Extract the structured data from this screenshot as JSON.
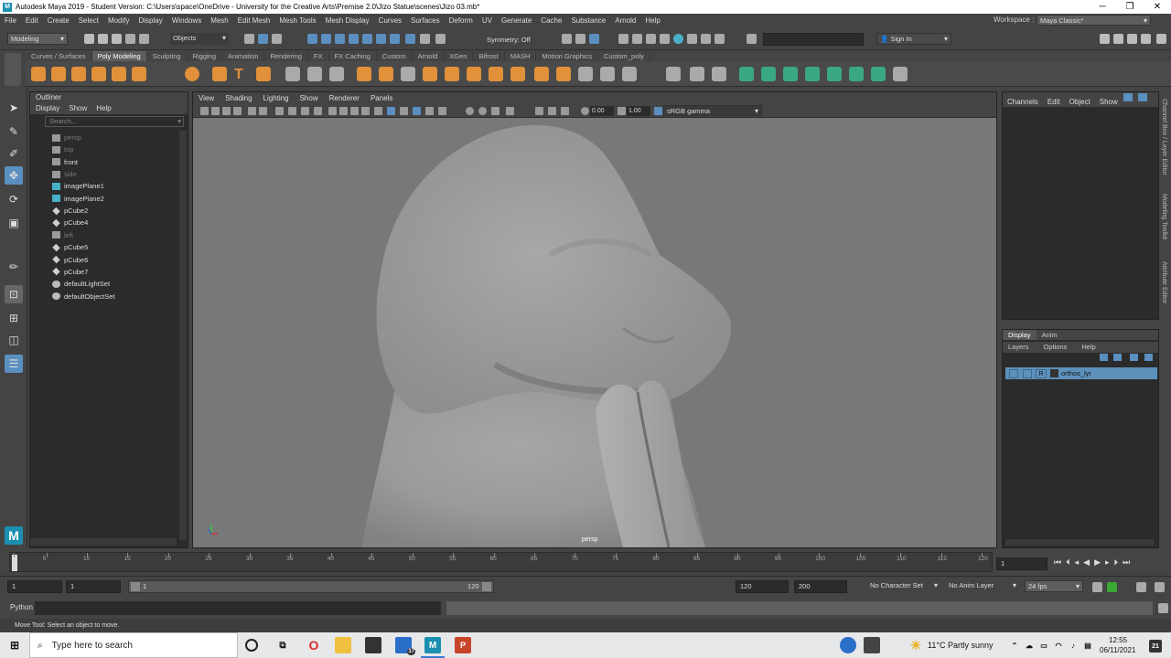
{
  "window": {
    "title": "Autodesk Maya 2019 - Student Version: C:\\Users\\space\\OneDrive - University for the Creative Arts\\Premise 2.0\\Jizo Statue\\scenes\\Jizo 03.mb*",
    "workspace_label": "Workspace :",
    "workspace_value": "Maya Classic*"
  },
  "menubar": [
    "File",
    "Edit",
    "Create",
    "Select",
    "Modify",
    "Display",
    "Windows",
    "Mesh",
    "Edit Mesh",
    "Mesh Tools",
    "Mesh Display",
    "Curves",
    "Surfaces",
    "Deform",
    "UV",
    "Generate",
    "Cache",
    "Substance",
    "Arnold",
    "Help"
  ],
  "statusline": {
    "menuset": "Modeling",
    "objects": "Objects",
    "symmetry": "Symmetry: Off",
    "sign_in": "Sign In"
  },
  "shelf_tabs": [
    "Curves / Surfaces",
    "Poly Modeling",
    "Sculpting",
    "Rigging",
    "Animation",
    "Rendering",
    "FX",
    "FX Caching",
    "Custom",
    "Arnold",
    "XGen",
    "Bifrost",
    "MASH",
    "Motion Graphics",
    "Custom_poly"
  ],
  "shelf_active": "Poly Modeling",
  "outliner": {
    "title": "Outliner",
    "menu": [
      "Display",
      "Show",
      "Help"
    ],
    "search_placeholder": "Search...",
    "items": [
      {
        "label": "persp",
        "dim": true,
        "icon": "camera-icon"
      },
      {
        "label": "top",
        "dim": true,
        "icon": "camera-icon"
      },
      {
        "label": "front",
        "dim": false,
        "icon": "camera-icon"
      },
      {
        "label": "side",
        "dim": true,
        "icon": "camera-icon"
      },
      {
        "label": "imagePlane1",
        "dim": false,
        "icon": "image-plane-icon"
      },
      {
        "label": "imagePlane2",
        "dim": false,
        "icon": "image-plane-icon"
      },
      {
        "label": "pCube2",
        "dim": false,
        "icon": "mesh-icon"
      },
      {
        "label": "pCube4",
        "dim": false,
        "icon": "mesh-icon"
      },
      {
        "label": "left",
        "dim": true,
        "icon": "camera-icon"
      },
      {
        "label": "pCube5",
        "dim": false,
        "icon": "mesh-icon"
      },
      {
        "label": "pCube6",
        "dim": false,
        "icon": "mesh-icon"
      },
      {
        "label": "pCube7",
        "dim": false,
        "icon": "mesh-icon"
      },
      {
        "label": "defaultLightSet",
        "dim": false,
        "icon": "set-icon"
      },
      {
        "label": "defaultObjectSet",
        "dim": false,
        "icon": "set-icon"
      }
    ]
  },
  "viewport": {
    "menu": [
      "View",
      "Shading",
      "Lighting",
      "Show",
      "Renderer",
      "Panels"
    ],
    "value1": "0.00",
    "value2": "1.00",
    "colorspace": "sRGB gamma",
    "camera_label": "persp"
  },
  "channelbox": {
    "menu": [
      "Channels",
      "Edit",
      "Object",
      "Show"
    ]
  },
  "layers": {
    "tabs": [
      "Display",
      "Anim"
    ],
    "menu": [
      "Layers",
      "Options",
      "Help"
    ],
    "layer_name": "orthos_lyr",
    "r_label": "R"
  },
  "side_tabs": [
    "Channel Box / Layer Editor",
    "Modeling Toolkit",
    "Attribute Editor"
  ],
  "timeline": {
    "ticks": [
      1,
      5,
      10,
      15,
      20,
      25,
      30,
      35,
      40,
      45,
      50,
      55,
      60,
      65,
      70,
      75,
      80,
      85,
      90,
      95,
      100,
      105,
      110,
      115,
      120
    ],
    "current_frame": "1"
  },
  "range": {
    "start": "1",
    "start2": "1",
    "slider_start": "1",
    "slider_end": "120",
    "end": "120",
    "end2": "200",
    "char_set": "No Character Set",
    "anim_layer": "No Anim Layer",
    "fps": "24 fps"
  },
  "cmdline": {
    "label": "Python"
  },
  "helpline": "Move Tool: Select an object to move.",
  "taskbar": {
    "search": "Type here to search",
    "weather": "11°C  Partly sunny",
    "time": "12:55",
    "date": "06/11/2021",
    "notif_count": "21",
    "mail_badge": "17"
  }
}
